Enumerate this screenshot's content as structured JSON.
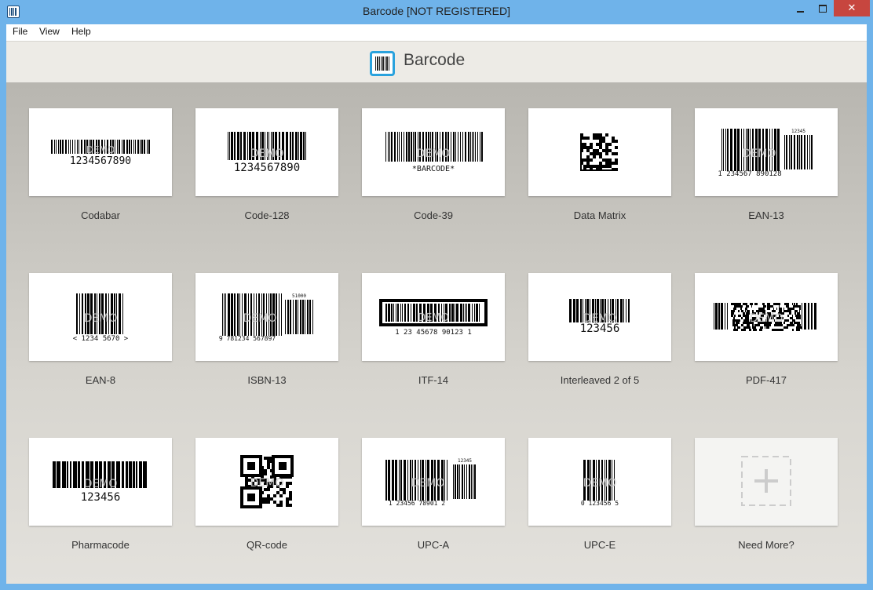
{
  "window": {
    "title": "Barcode [NOT REGISTERED]",
    "close_glyph": "✕"
  },
  "menu": [
    "File",
    "View",
    "Help"
  ],
  "header": {
    "app_name": "Barcode"
  },
  "barcodes": [
    {
      "label": "Codabar",
      "human_text": "1234567890"
    },
    {
      "label": "Code-128",
      "human_text": "1234567890"
    },
    {
      "label": "Code-39",
      "human_text": "*BARCODE*"
    },
    {
      "label": "Data Matrix",
      "human_text": ""
    },
    {
      "label": "EAN-13",
      "human_text": "1  234567  890128",
      "supplement": "12345"
    },
    {
      "label": "EAN-8",
      "human_text": "<  1234  5670  >"
    },
    {
      "label": "ISBN-13",
      "human_text": "9  781234  567897",
      "supplement": "51000"
    },
    {
      "label": "ITF-14",
      "human_text": "1  23  45678  90123  1"
    },
    {
      "label": "Interleaved 2 of 5",
      "human_text": "123456"
    },
    {
      "label": "PDF-417",
      "human_text": ""
    },
    {
      "label": "Pharmacode",
      "human_text": "123456"
    },
    {
      "label": "QR-code",
      "human_text": ""
    },
    {
      "label": "UPC-A",
      "human_text": "1  23456  78901  2",
      "supplement": "12345"
    },
    {
      "label": "UPC-E",
      "human_text": "0  123456  5"
    },
    {
      "label": "Need More?",
      "human_text": ""
    }
  ],
  "watermark_text": "DEMO",
  "colors": {
    "accent": "#2aa2dd",
    "close_button": "#c7463f",
    "titlebar": "#6fb3ea"
  }
}
